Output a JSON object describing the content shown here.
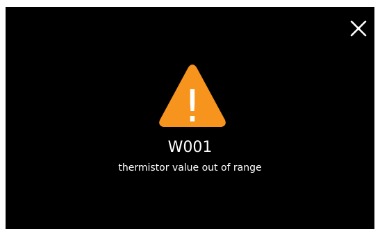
{
  "dialog": {
    "close_icon": "close-icon",
    "warning_icon": "warning-triangle-icon",
    "warning_icon_glyph": "!",
    "code": "W001",
    "message": "thermistor value out of range"
  },
  "colors": {
    "background": "#000000",
    "warning": "#f7941d",
    "text": "#ffffff"
  }
}
